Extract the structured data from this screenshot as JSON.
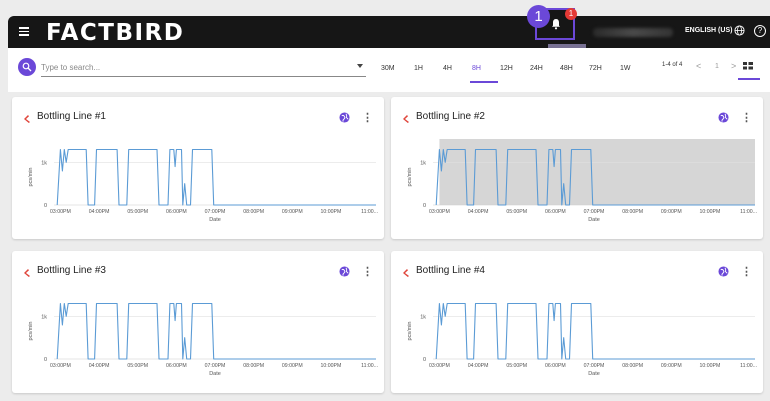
{
  "app": {
    "logo": "FACTBIRD",
    "language": "ENGLISH (US)",
    "help": "?",
    "notification_count": "1",
    "step_marker": "1"
  },
  "toolbar": {
    "search_placeholder": "Type to search...",
    "time_ranges": [
      "30M",
      "1H",
      "4H",
      "8H",
      "12H",
      "24H",
      "48H",
      "72H",
      "1W"
    ],
    "active_range": "8H",
    "pager_label": "1-4 of 4",
    "pager_prev": "<",
    "pager_page": "1",
    "pager_next": ">"
  },
  "icons": {
    "menu": "menu-icon",
    "bell": "bell-icon",
    "globe": "globe-icon",
    "help": "help-icon",
    "search": "search-icon",
    "view": "grid-view-icon",
    "line": "production-line-icon",
    "more": "more-vert-icon"
  },
  "colors": {
    "accent": "#6b48d8",
    "badge": "#e53935",
    "line": "#5b9bd5",
    "line_icon": "#e0463c",
    "topbar": "#161616"
  },
  "cards": [
    {
      "title": "Bottling Line #1",
      "highlight": false
    },
    {
      "title": "Bottling Line #2",
      "highlight": true
    },
    {
      "title": "Bottling Line #3",
      "highlight": false
    },
    {
      "title": "Bottling Line #4",
      "highlight": false
    }
  ],
  "chart_data": {
    "type": "line",
    "xlabel": "Date",
    "ylabel": "pcs/min",
    "x_ticks": [
      "03:00PM",
      "04:00PM",
      "05:00PM",
      "06:00PM",
      "07:00PM",
      "08:00PM",
      "09:00PM",
      "10:00PM",
      "11:00..."
    ],
    "y_ticks": [
      "0",
      "1k"
    ],
    "xlim": [
      "02:50PM",
      "11:10PM"
    ],
    "ylim": [
      0,
      1500
    ],
    "series": [
      {
        "points": [
          [
            "02:55PM",
            0
          ],
          [
            "03:00PM",
            1300
          ],
          [
            "03:03PM",
            800
          ],
          [
            "03:06PM",
            1300
          ],
          [
            "03:09PM",
            1000
          ],
          [
            "03:12PM",
            1300
          ],
          [
            "03:40PM",
            1300
          ],
          [
            "03:43PM",
            0
          ],
          [
            "03:53PM",
            0
          ],
          [
            "03:56PM",
            1300
          ],
          [
            "04:28PM",
            1300
          ],
          [
            "04:31PM",
            0
          ],
          [
            "04:43PM",
            0
          ],
          [
            "04:46PM",
            1300
          ],
          [
            "05:30PM",
            1300
          ],
          [
            "05:33PM",
            0
          ],
          [
            "05:47PM",
            0
          ],
          [
            "05:50PM",
            1300
          ],
          [
            "05:56PM",
            1300
          ],
          [
            "05:58PM",
            900
          ],
          [
            "06:00PM",
            1300
          ],
          [
            "06:08PM",
            1300
          ],
          [
            "06:10PM",
            0
          ],
          [
            "06:13PM",
            500
          ],
          [
            "06:16PM",
            0
          ],
          [
            "06:22PM",
            0
          ],
          [
            "06:25PM",
            1300
          ],
          [
            "06:55PM",
            1300
          ],
          [
            "06:58PM",
            0
          ],
          [
            "11:10PM",
            0
          ]
        ]
      }
    ]
  }
}
